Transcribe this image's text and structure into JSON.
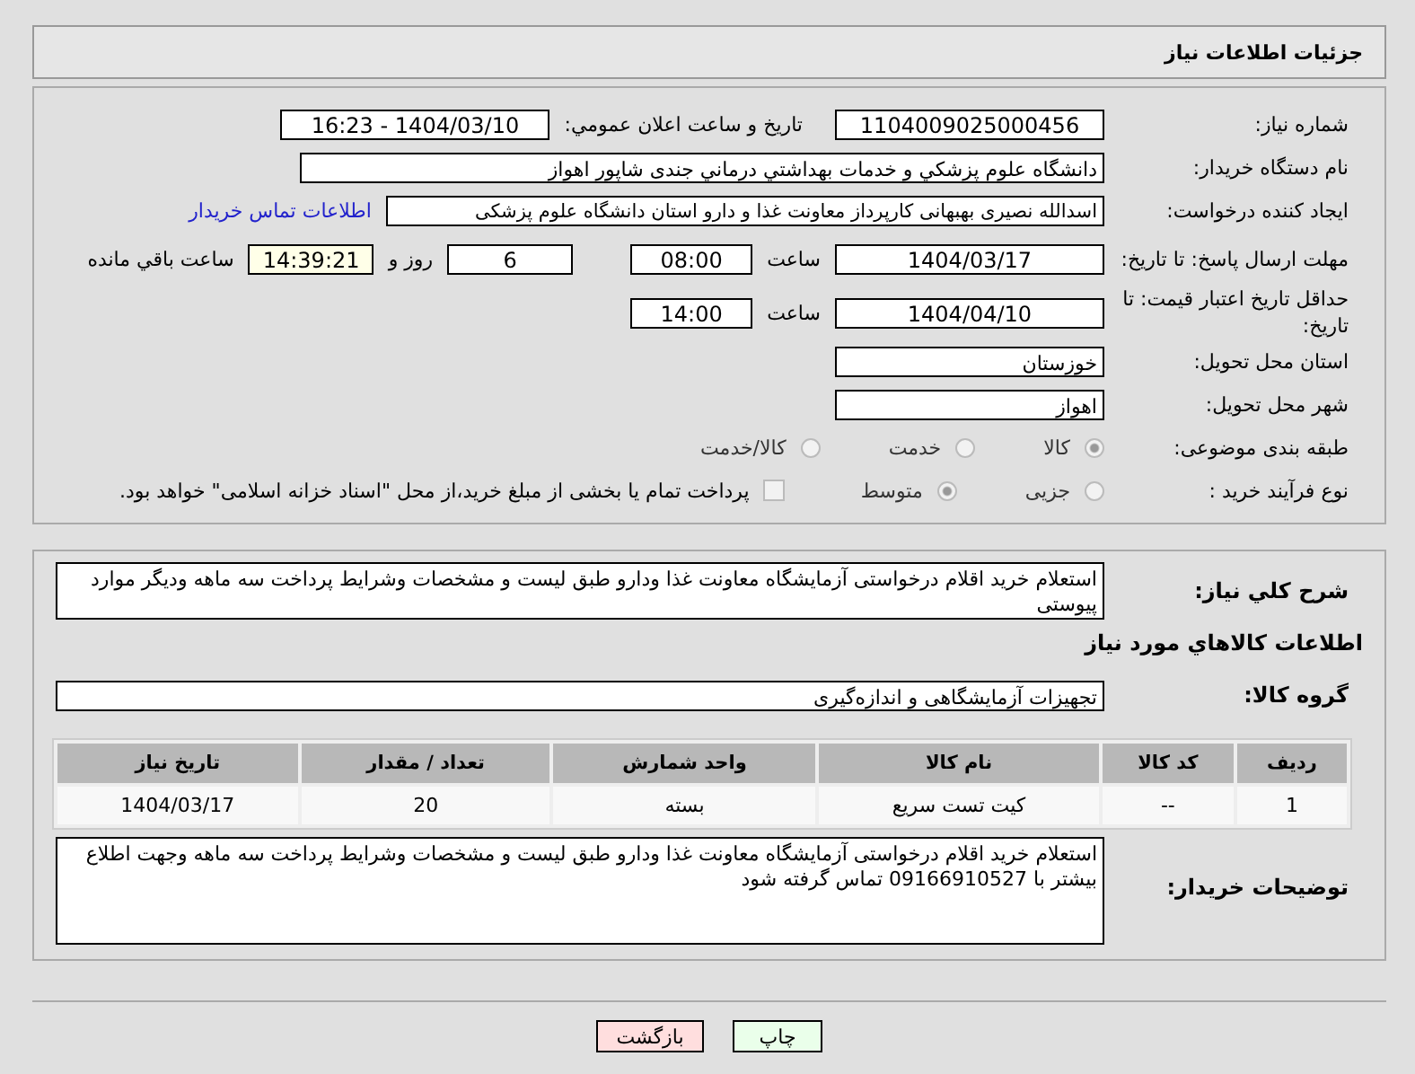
{
  "header": {
    "title": "جزئیات اطلاعات نیاز"
  },
  "fields": {
    "need_number": {
      "label": "شماره نیاز:",
      "value": "1104009025000456"
    },
    "announce": {
      "label": "تاریخ و ساعت اعلان عمومي:",
      "value": "1404/03/10 - 16:23"
    },
    "buyer_org": {
      "label": "نام دستگاه خریدار:",
      "value": "دانشگاه علوم پزشكي و خدمات بهداشتي درماني جندی شاپور اهواز"
    },
    "requester": {
      "label": "ایجاد کننده درخواست:",
      "value": "اسدالله نصیری بهبهانی کارپرداز معاونت غذا و دارو استان دانشگاه علوم پزشکی",
      "link": "اطلاعات تماس خریدار"
    },
    "deadline": {
      "label": "مهلت ارسال پاسخ: تا تاریخ:",
      "date": "1404/03/17",
      "time_label": "ساعت",
      "time": "08:00",
      "days": "6",
      "days_label": "روز و",
      "remaining": "14:39:21",
      "remaining_label": "ساعت باقي مانده"
    },
    "validity": {
      "label": "حداقل تاریخ اعتبار قیمت: تا تاریخ:",
      "date": "1404/04/10",
      "time_label": "ساعت",
      "time": "14:00"
    },
    "province": {
      "label": "استان محل تحویل:",
      "value": "خوزستان"
    },
    "city": {
      "label": "شهر محل تحویل:",
      "value": "اهواز"
    },
    "category": {
      "label": "طبقه بندی موضوعی:",
      "options": [
        {
          "label": "کالا",
          "selected": true
        },
        {
          "label": "خدمت",
          "selected": false
        },
        {
          "label": "کالا/خدمت",
          "selected": false
        }
      ]
    },
    "purchase_type": {
      "label": "نوع فرآیند خرید :",
      "options": [
        {
          "label": "جزیی",
          "selected": false
        },
        {
          "label": "متوسط",
          "selected": true
        }
      ],
      "treasury": {
        "checked": false,
        "text": "پرداخت تمام یا بخشی از مبلغ خرید،از محل \"اسناد خزانه اسلامی\" خواهد بود."
      }
    }
  },
  "description": {
    "label": "شرح کلي نیاز:",
    "value": "استعلام خرید اقلام درخواستی  آزمایشگاه  معاونت غذا ودارو طبق لیست و مشخصات  وشرایط پرداخت  سه ماهه ودیگر موارد پیوستی"
  },
  "goods_heading": "اطلاعات کالاهاي مورد نیاز",
  "goods_group": {
    "label": "گروه کالا:",
    "value": "تجهیزات آزمایشگاهی و اندازه‌گیری"
  },
  "table": {
    "columns": [
      "ردیف",
      "کد کالا",
      "نام کالا",
      "واحد شمارش",
      "تعداد / مقدار",
      "تاریخ نیاز"
    ],
    "rows": [
      [
        "1",
        "--",
        "کیت تست سریع",
        "بسته",
        "20",
        "1404/03/17"
      ]
    ]
  },
  "buyer_notes": {
    "label": "توضیحات خریدار:",
    "value": "استعلام خرید اقلام درخواستی  آزمایشگاه  معاونت غذا ودارو طبق لیست و مشخصات  وشرایط پرداخت  سه ماهه وجهت اطلاع بیشتر با 09166910527 تماس گرفته شود"
  },
  "buttons": [
    {
      "label": "چاپ",
      "kind": "print"
    },
    {
      "label": "بازگشت",
      "kind": "back"
    }
  ]
}
